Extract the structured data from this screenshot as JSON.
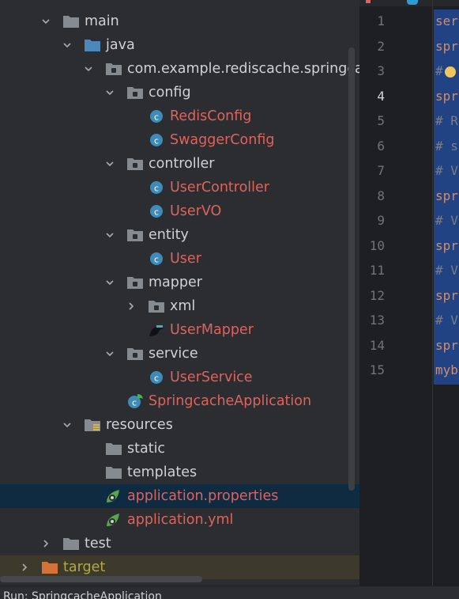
{
  "tree": [
    {
      "key": "main",
      "label": "main",
      "depth": 0,
      "expand": "open",
      "icon": "folder",
      "cls": ""
    },
    {
      "key": "java",
      "label": "java",
      "depth": 1,
      "expand": "open",
      "icon": "folder-blue",
      "cls": ""
    },
    {
      "key": "package",
      "label": "com.example.rediscache.springcache",
      "depth": 2,
      "expand": "open",
      "icon": "package",
      "cls": ""
    },
    {
      "key": "config",
      "label": "config",
      "depth": 3,
      "expand": "open",
      "icon": "package",
      "cls": ""
    },
    {
      "key": "redisconfig",
      "label": "RedisConfig",
      "depth": 4,
      "expand": "none",
      "icon": "class",
      "cls": "cls"
    },
    {
      "key": "swaggerconfig",
      "label": "SwaggerConfig",
      "depth": 4,
      "expand": "none",
      "icon": "class",
      "cls": "cls"
    },
    {
      "key": "controller",
      "label": "controller",
      "depth": 3,
      "expand": "open",
      "icon": "package",
      "cls": ""
    },
    {
      "key": "usercontroller",
      "label": "UserController",
      "depth": 4,
      "expand": "none",
      "icon": "class",
      "cls": "cls"
    },
    {
      "key": "uservo",
      "label": "UserVO",
      "depth": 4,
      "expand": "none",
      "icon": "class",
      "cls": "cls"
    },
    {
      "key": "entity",
      "label": "entity",
      "depth": 3,
      "expand": "open",
      "icon": "package",
      "cls": ""
    },
    {
      "key": "user",
      "label": "User",
      "depth": 4,
      "expand": "none",
      "icon": "class",
      "cls": "cls"
    },
    {
      "key": "mapper",
      "label": "mapper",
      "depth": 3,
      "expand": "open",
      "icon": "package",
      "cls": ""
    },
    {
      "key": "xml",
      "label": "xml",
      "depth": 4,
      "expand": "closed",
      "icon": "package",
      "cls": ""
    },
    {
      "key": "usermapper",
      "label": "UserMapper",
      "depth": 4,
      "expand": "none",
      "icon": "mybatis",
      "cls": "cls"
    },
    {
      "key": "service",
      "label": "service",
      "depth": 3,
      "expand": "open",
      "icon": "package",
      "cls": ""
    },
    {
      "key": "userservice",
      "label": "UserService",
      "depth": 4,
      "expand": "none",
      "icon": "class",
      "cls": "cls"
    },
    {
      "key": "springcacheapp",
      "label": "SpringcacheApplication",
      "depth": 3,
      "expand": "none",
      "icon": "spring-class",
      "cls": "cls"
    },
    {
      "key": "resources",
      "label": "resources",
      "depth": 1,
      "expand": "open",
      "icon": "resources",
      "cls": ""
    },
    {
      "key": "static",
      "label": "static",
      "depth": 2,
      "expand": "none",
      "icon": "folder",
      "cls": ""
    },
    {
      "key": "templates",
      "label": "templates",
      "depth": 2,
      "expand": "none",
      "icon": "folder",
      "cls": ""
    },
    {
      "key": "appprops",
      "label": "application.properties",
      "depth": 2,
      "expand": "none",
      "icon": "spring-config",
      "cls": "cls",
      "selected": true
    },
    {
      "key": "appyml",
      "label": "application.yml",
      "depth": 2,
      "expand": "none",
      "icon": "spring-config",
      "cls": "cls"
    },
    {
      "key": "test",
      "label": "test",
      "depth": 0,
      "expand": "closed",
      "icon": "folder",
      "cls": ""
    },
    {
      "key": "target",
      "label": "target",
      "depth": -1,
      "expand": "closed",
      "icon": "folder-orange",
      "cls": "target"
    }
  ],
  "editor": {
    "line_numbers": [
      "1",
      "2",
      "3",
      "4",
      "5",
      "6",
      "7",
      "8",
      "9",
      "10",
      "11",
      "12",
      "13",
      "14",
      "15"
    ],
    "current_line": "4",
    "lines": [
      {
        "text": "ser",
        "type": "key"
      },
      {
        "text": "spr",
        "type": "key"
      },
      {
        "text": "#",
        "type": "comment"
      },
      {
        "text": "spr",
        "type": "key"
      },
      {
        "text": "# R",
        "type": "comment"
      },
      {
        "text": "# s",
        "type": "comment"
      },
      {
        "text": "# V",
        "type": "comment"
      },
      {
        "text": "spr",
        "type": "key"
      },
      {
        "text": "# V",
        "type": "comment"
      },
      {
        "text": "spr",
        "type": "key"
      },
      {
        "text": "# V",
        "type": "comment"
      },
      {
        "text": "spr",
        "type": "key"
      },
      {
        "text": "# V",
        "type": "comment"
      },
      {
        "text": "spr",
        "type": "key"
      },
      {
        "text": "myb",
        "type": "key"
      }
    ]
  },
  "status": {
    "text": "Run:   SpringcacheApplication"
  },
  "colors": {
    "class_file": "#e0625d",
    "selection": "#0e2b41",
    "code_selection": "#214283"
  }
}
